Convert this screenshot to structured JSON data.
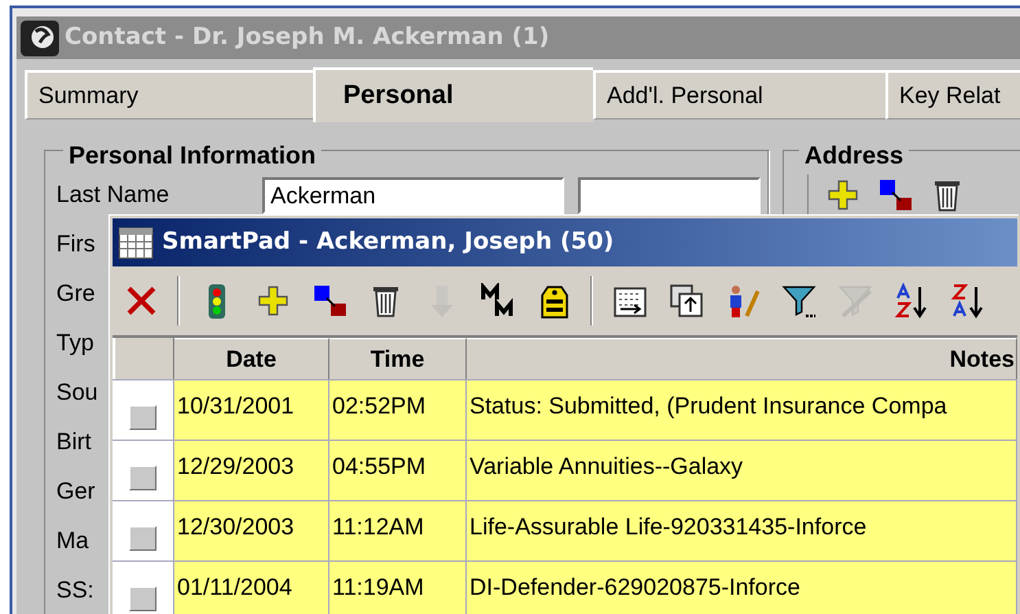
{
  "contact_window": {
    "title": "Contact - Dr. Joseph M. Ackerman (1)"
  },
  "tabs": [
    {
      "label": "Summary",
      "selected": false
    },
    {
      "label": "Personal",
      "selected": true
    },
    {
      "label": "Add'l. Personal",
      "selected": false
    },
    {
      "label": "Key Relat",
      "selected": false
    }
  ],
  "personal_information": {
    "title": "Personal Information",
    "fields": [
      {
        "label": "Last Name",
        "value": "Ackerman"
      },
      {
        "label": "Firs"
      },
      {
        "label": "Gre"
      },
      {
        "label": "Typ"
      },
      {
        "label": "Sou"
      },
      {
        "label": "Birt"
      },
      {
        "label": "Ger"
      },
      {
        "label": "Ma"
      },
      {
        "label": "SS:"
      }
    ]
  },
  "address": {
    "title": "Address",
    "toolbar": [
      {
        "kind": "add"
      },
      {
        "kind": "link"
      },
      {
        "kind": "trash"
      }
    ]
  },
  "smartpad_window": {
    "title": "SmartPad - Ackerman, Joseph (50)"
  },
  "toolbar_groups": [
    {
      "buttons": [
        {
          "kind": "delete",
          "disabled": false
        }
      ]
    },
    {
      "buttons": [
        {
          "kind": "status",
          "disabled": false
        },
        {
          "kind": "add",
          "disabled": false
        },
        {
          "kind": "link",
          "disabled": false
        },
        {
          "kind": "trash",
          "disabled": false
        },
        {
          "kind": "down",
          "disabled": true
        },
        {
          "kind": "merge",
          "disabled": false
        },
        {
          "kind": "tag",
          "disabled": false
        }
      ]
    },
    {
      "buttons": [
        {
          "kind": "calendar",
          "disabled": false
        },
        {
          "kind": "copy",
          "disabled": false
        },
        {
          "kind": "person",
          "disabled": false
        },
        {
          "kind": "filter",
          "disabled": false
        },
        {
          "kind": "unfilter",
          "disabled": true
        },
        {
          "kind": "sort_asc",
          "disabled": false
        },
        {
          "kind": "sort_desc",
          "disabled": false
        }
      ]
    }
  ],
  "table": {
    "columns": [
      "Date",
      "Time",
      "Notes"
    ],
    "rows": [
      {
        "checked": false,
        "date": "10/31/2001",
        "time": "02:52PM",
        "notes": "Status: Submitted,   (Prudent Insurance Compa"
      },
      {
        "checked": false,
        "date": "12/29/2003",
        "time": "04:55PM",
        "notes": "Variable Annuities--Galaxy"
      },
      {
        "checked": false,
        "date": "12/30/2003",
        "time": "11:12AM",
        "notes": "Life-Assurable Life-920331435-Inforce"
      },
      {
        "checked": false,
        "date": "01/11/2004",
        "time": "11:19AM",
        "notes": "DI-Defender-629020875-Inforce"
      }
    ]
  }
}
